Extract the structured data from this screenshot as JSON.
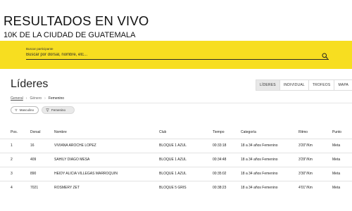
{
  "header": {
    "title": "RESULTADOS EN VIVO",
    "subtitle": "10K DE LA CIUDAD DE GUATEMALA"
  },
  "search": {
    "label": "Buscar participante",
    "placeholder": "Buscar por dorsal, nombre, etc...",
    "icon": "search-icon"
  },
  "main": {
    "title": "Líderes",
    "tabs": [
      {
        "label": "LÍDERES",
        "active": true
      },
      {
        "label": "INDIVIDUAL",
        "active": false
      },
      {
        "label": "TROFEOS",
        "active": false
      },
      {
        "label": "MAPA",
        "active": false
      }
    ],
    "breadcrumb": {
      "root": "General",
      "mid": "Género",
      "current": "Femenino"
    },
    "filters": [
      {
        "label": "Masculino",
        "selected": false
      },
      {
        "label": "Femenino",
        "selected": true
      }
    ]
  },
  "table": {
    "columns": [
      "Pos.",
      "Dorsal",
      "Nombre",
      "Club",
      "Tiempo",
      "Categoría",
      "Ritmo",
      "Punto"
    ],
    "rows": [
      [
        "1",
        "16",
        "VIVIANA AROCHE LOPEZ",
        "BLOQUE 1 AZUL",
        "00:33:18",
        "18 a 34 años Femenino",
        "3'20\"/Km",
        "Meta"
      ],
      [
        "2",
        "409",
        "SAHILY DIAGO MESA",
        "BLOQUE 1 AZUL",
        "00:34:48",
        "18 a 34 años Femenino",
        "3'29\"/Km",
        "Meta"
      ],
      [
        "3",
        "890",
        "HEIDY ALICIA VILLEGAS MARROQUIN",
        "BLOQUE 1 AZUL",
        "00:35:02",
        "18 a 34 años Femenino",
        "3'30\"/Km",
        "Meta"
      ],
      [
        "4",
        "7021",
        "ROSMERY ZET",
        "BLOQUE 5 GRIS",
        "00:38:23",
        "18 a 34 años Femenino",
        "4'01\"/Km",
        "Meta"
      ]
    ]
  },
  "colors": {
    "accent": "#f7de20",
    "active_tab": "#e8e8e8"
  }
}
